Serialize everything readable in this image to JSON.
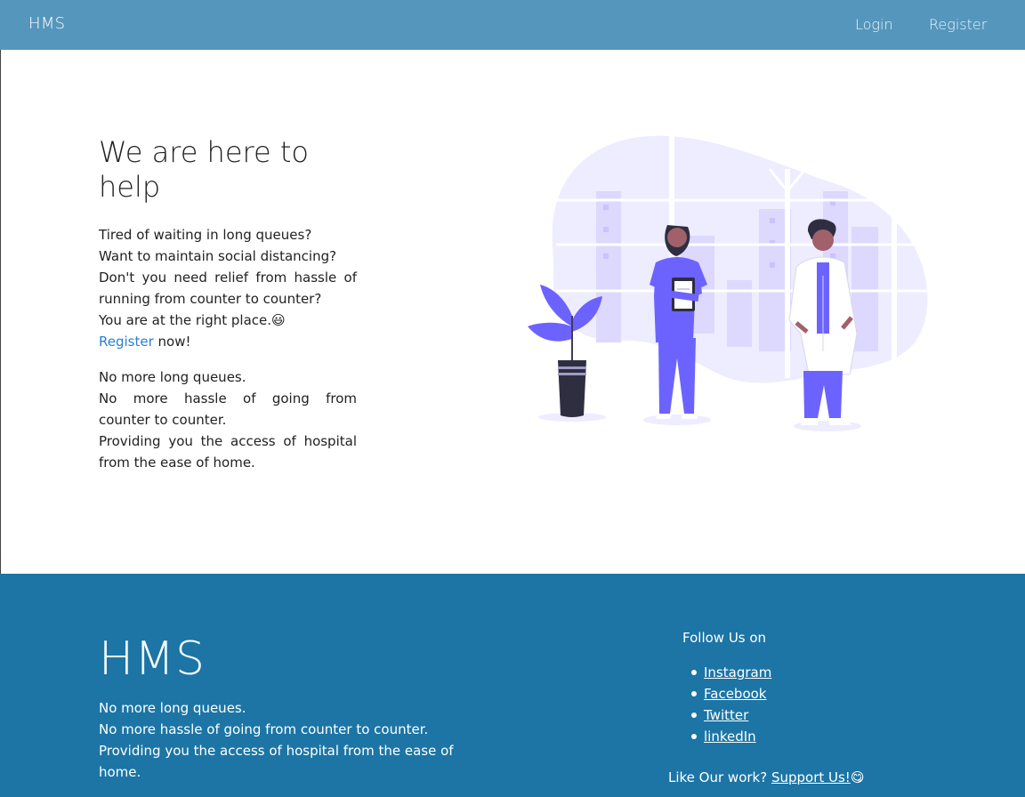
{
  "nav": {
    "brand": "HMS",
    "login": "Login",
    "register": "Register"
  },
  "hero": {
    "title_line1": "We are here to",
    "title_line2": "help",
    "p1": {
      "l1": "Tired of waiting in long queues?",
      "l2": "Want to maintain social distancing?",
      "l3": "Don't you need relief from hassle of",
      "l4": "running from counter to counter?",
      "l5": "You are at the right place.",
      "l5_emoji": "😃",
      "register_link": "Register",
      "l6_after": " now!"
    },
    "p2": {
      "l1": "No more long queues.",
      "l2": "No more hassle of going from",
      "l3": "counter to counter.",
      "l4": "Providing you the access of hospital",
      "l5": "from the ease of home."
    }
  },
  "footer": {
    "brand": "HMS",
    "text_l1": "No more long queues.",
    "text_l2": "No more hassle of going from counter to counter.",
    "text_l3": "Providing you the access of hospital from the ease of",
    "text_l4": "home.",
    "follow_label": "Follow Us on",
    "social": [
      "Instagram",
      "Facebook",
      "Twitter",
      "linkedIn"
    ],
    "like_text": "Like Our work? ",
    "support_link": "Support Us!",
    "support_emoji": "😋"
  },
  "colors": {
    "navbar": "#5596bd",
    "footer": "#1c75a5",
    "link": "#2a7fd4",
    "illustration_accent": "#6c63ff",
    "illustration_bg": "#eeecff"
  },
  "icons": {
    "illustration": "doctors-illustration"
  }
}
